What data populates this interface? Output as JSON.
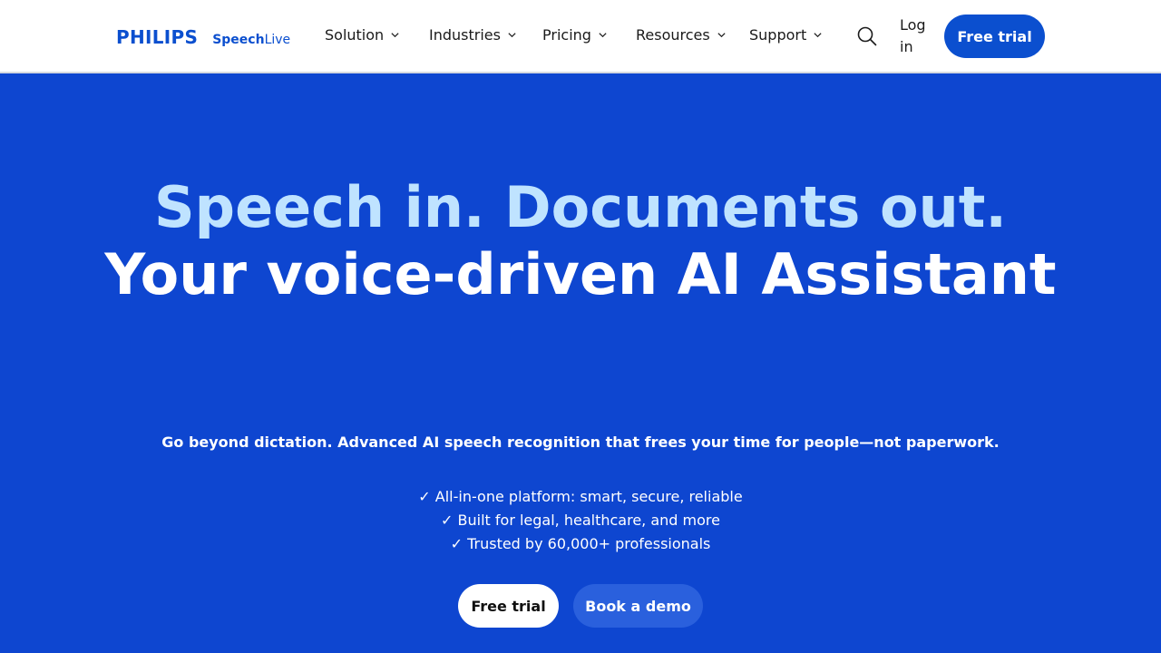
{
  "header": {
    "brand": {
      "logo_text": "PHILIPS",
      "product_bold": "Speech",
      "product_regular": "Live"
    },
    "nav": [
      {
        "label": "Solution",
        "icon": "chevron-down-icon"
      },
      {
        "label": "Industries",
        "icon": "chevron-down-icon"
      },
      {
        "label": "Pricing",
        "icon": "chevron-down-icon"
      },
      {
        "label": "Resources",
        "icon": "chevron-down-icon"
      },
      {
        "label": "Support",
        "icon": "chevron-down-icon"
      }
    ],
    "search_icon": "search-icon",
    "login_label": "Log in",
    "cta_label": "Free trial"
  },
  "hero": {
    "headline_line1": "Speech in. Documents out.",
    "headline_line2": "Your voice-driven AI Assistant",
    "subtitle": "Go beyond dictation. Advanced AI speech recognition that frees your time for people—not paperwork.",
    "features": [
      "✓ All-in-one platform: smart, secure, reliable",
      "✓ Built for legal, healthcare, and more",
      "✓ Trusted by 60,000+ professionals"
    ],
    "primary_cta": "Free trial",
    "secondary_cta": "Book a demo"
  },
  "colors": {
    "brand_blue": "#0b4fcf",
    "hero_background": "#0e46d0",
    "headline_accent": "#bfe3ff",
    "secondary_button": "#2a60dd"
  }
}
